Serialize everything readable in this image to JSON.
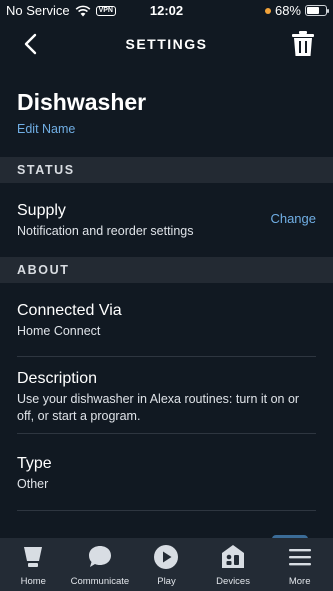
{
  "status_bar": {
    "carrier": "No Service",
    "vpn": "VPN",
    "time": "12:02",
    "battery_text": "68%",
    "battery_level": 0.68
  },
  "header": {
    "title": "SETTINGS"
  },
  "device": {
    "name": "Dishwasher",
    "edit_label": "Edit Name"
  },
  "sections": {
    "status": "STATUS",
    "about": "ABOUT"
  },
  "supply": {
    "title": "Supply",
    "subtitle": "Notification and reorder settings",
    "action": "Change"
  },
  "about_rows": [
    {
      "title": "Connected Via",
      "subtitle": "Home Connect"
    },
    {
      "title": "Description",
      "subtitle": "Use your dishwasher in Alexa routines: turn it on or off, or start a program."
    },
    {
      "title": "Type",
      "subtitle": "Other"
    }
  ],
  "tabs": [
    {
      "label": "Home",
      "icon": "home-icon"
    },
    {
      "label": "Communicate",
      "icon": "chat-bubble-icon"
    },
    {
      "label": "Play",
      "icon": "play-icon"
    },
    {
      "label": "Devices",
      "icon": "devices-icon"
    },
    {
      "label": "More",
      "icon": "menu-icon"
    }
  ],
  "colors": {
    "background": "#111922",
    "section_bg": "#232a33",
    "link": "#70aee4",
    "tabbar_bg": "#232b35"
  }
}
